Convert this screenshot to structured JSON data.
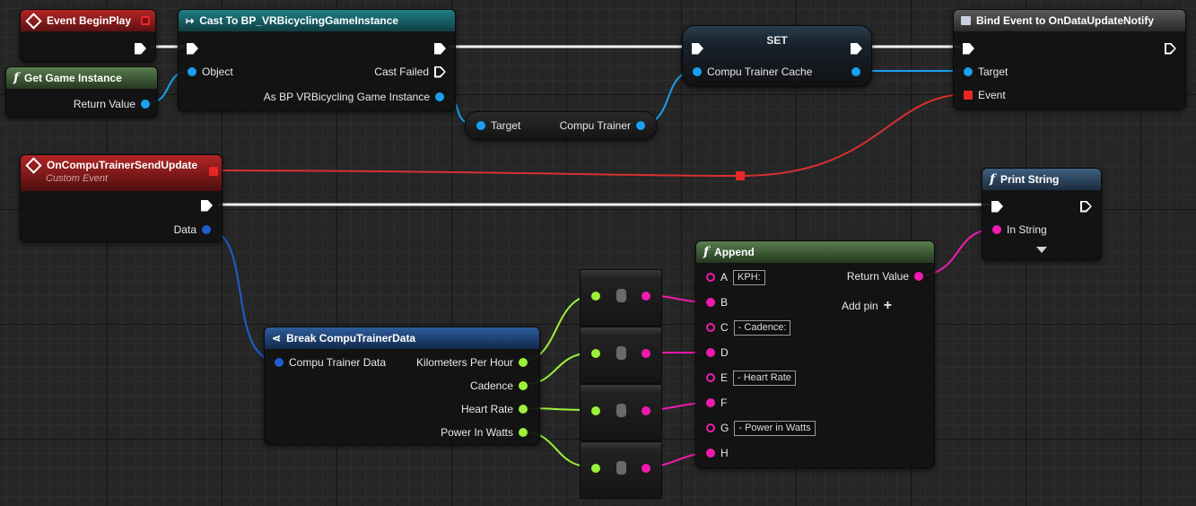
{
  "nodes": {
    "begin_play": {
      "title": "Event BeginPlay"
    },
    "cast": {
      "title": "Cast To BP_VRBicyclingGameInstance",
      "object": "Object",
      "cast_failed": "Cast Failed",
      "as_output": "As BP VRBicycling Game Instance"
    },
    "get_game_instance": {
      "title": "Get Game Instance",
      "return_value": "Return Value"
    },
    "set": {
      "title": "SET",
      "var": "Compu Trainer Cache"
    },
    "getter": {
      "target": "Target",
      "output": "Compu Trainer"
    },
    "bind_event": {
      "title": "Bind Event to OnDataUpdateNotify",
      "target": "Target",
      "event": "Event"
    },
    "custom_event": {
      "title": "OnCompuTrainerSendUpdate",
      "subtitle": "Custom Event",
      "data": "Data"
    },
    "print_string": {
      "title": "Print String",
      "in_string": "In String"
    },
    "append": {
      "title": "Append",
      "return_value": "Return Value",
      "add_pin": "Add pin",
      "pins": [
        {
          "letter": "A",
          "value": "KPH:"
        },
        {
          "letter": "B",
          "value": ""
        },
        {
          "letter": "C",
          "value": " - Cadence: "
        },
        {
          "letter": "D",
          "value": ""
        },
        {
          "letter": "E",
          "value": " - Heart Rate"
        },
        {
          "letter": "F",
          "value": ""
        },
        {
          "letter": "G",
          "value": " - Power in Watts"
        },
        {
          "letter": "H",
          "value": ""
        }
      ]
    },
    "break": {
      "title": "Break CompuTrainerData",
      "input": "Compu Trainer Data",
      "outputs": [
        "Kilometers Per Hour",
        "Cadence",
        "Heart Rate",
        "Power In Watts"
      ]
    }
  },
  "colors": {
    "exec": "#ffffff",
    "object_pin": "#1aa0f0",
    "struct_pin": "#1d5dd0",
    "string_pin": "#f01ab0",
    "float_pin": "#9cf13a",
    "delegate_pin": "#e82727",
    "event_header": "#b32525",
    "cast_header": "#1f7e86",
    "function_header": "#587d4f",
    "break_header": "#2d5d9c"
  },
  "icons": {
    "event": "event-diamond-icon",
    "cast": "cast-arrow-icon",
    "function": "function-f-icon",
    "bind": "bind-event-icon",
    "break": "break-struct-icon",
    "add": "plus-icon",
    "expand": "chevron-down-icon"
  }
}
